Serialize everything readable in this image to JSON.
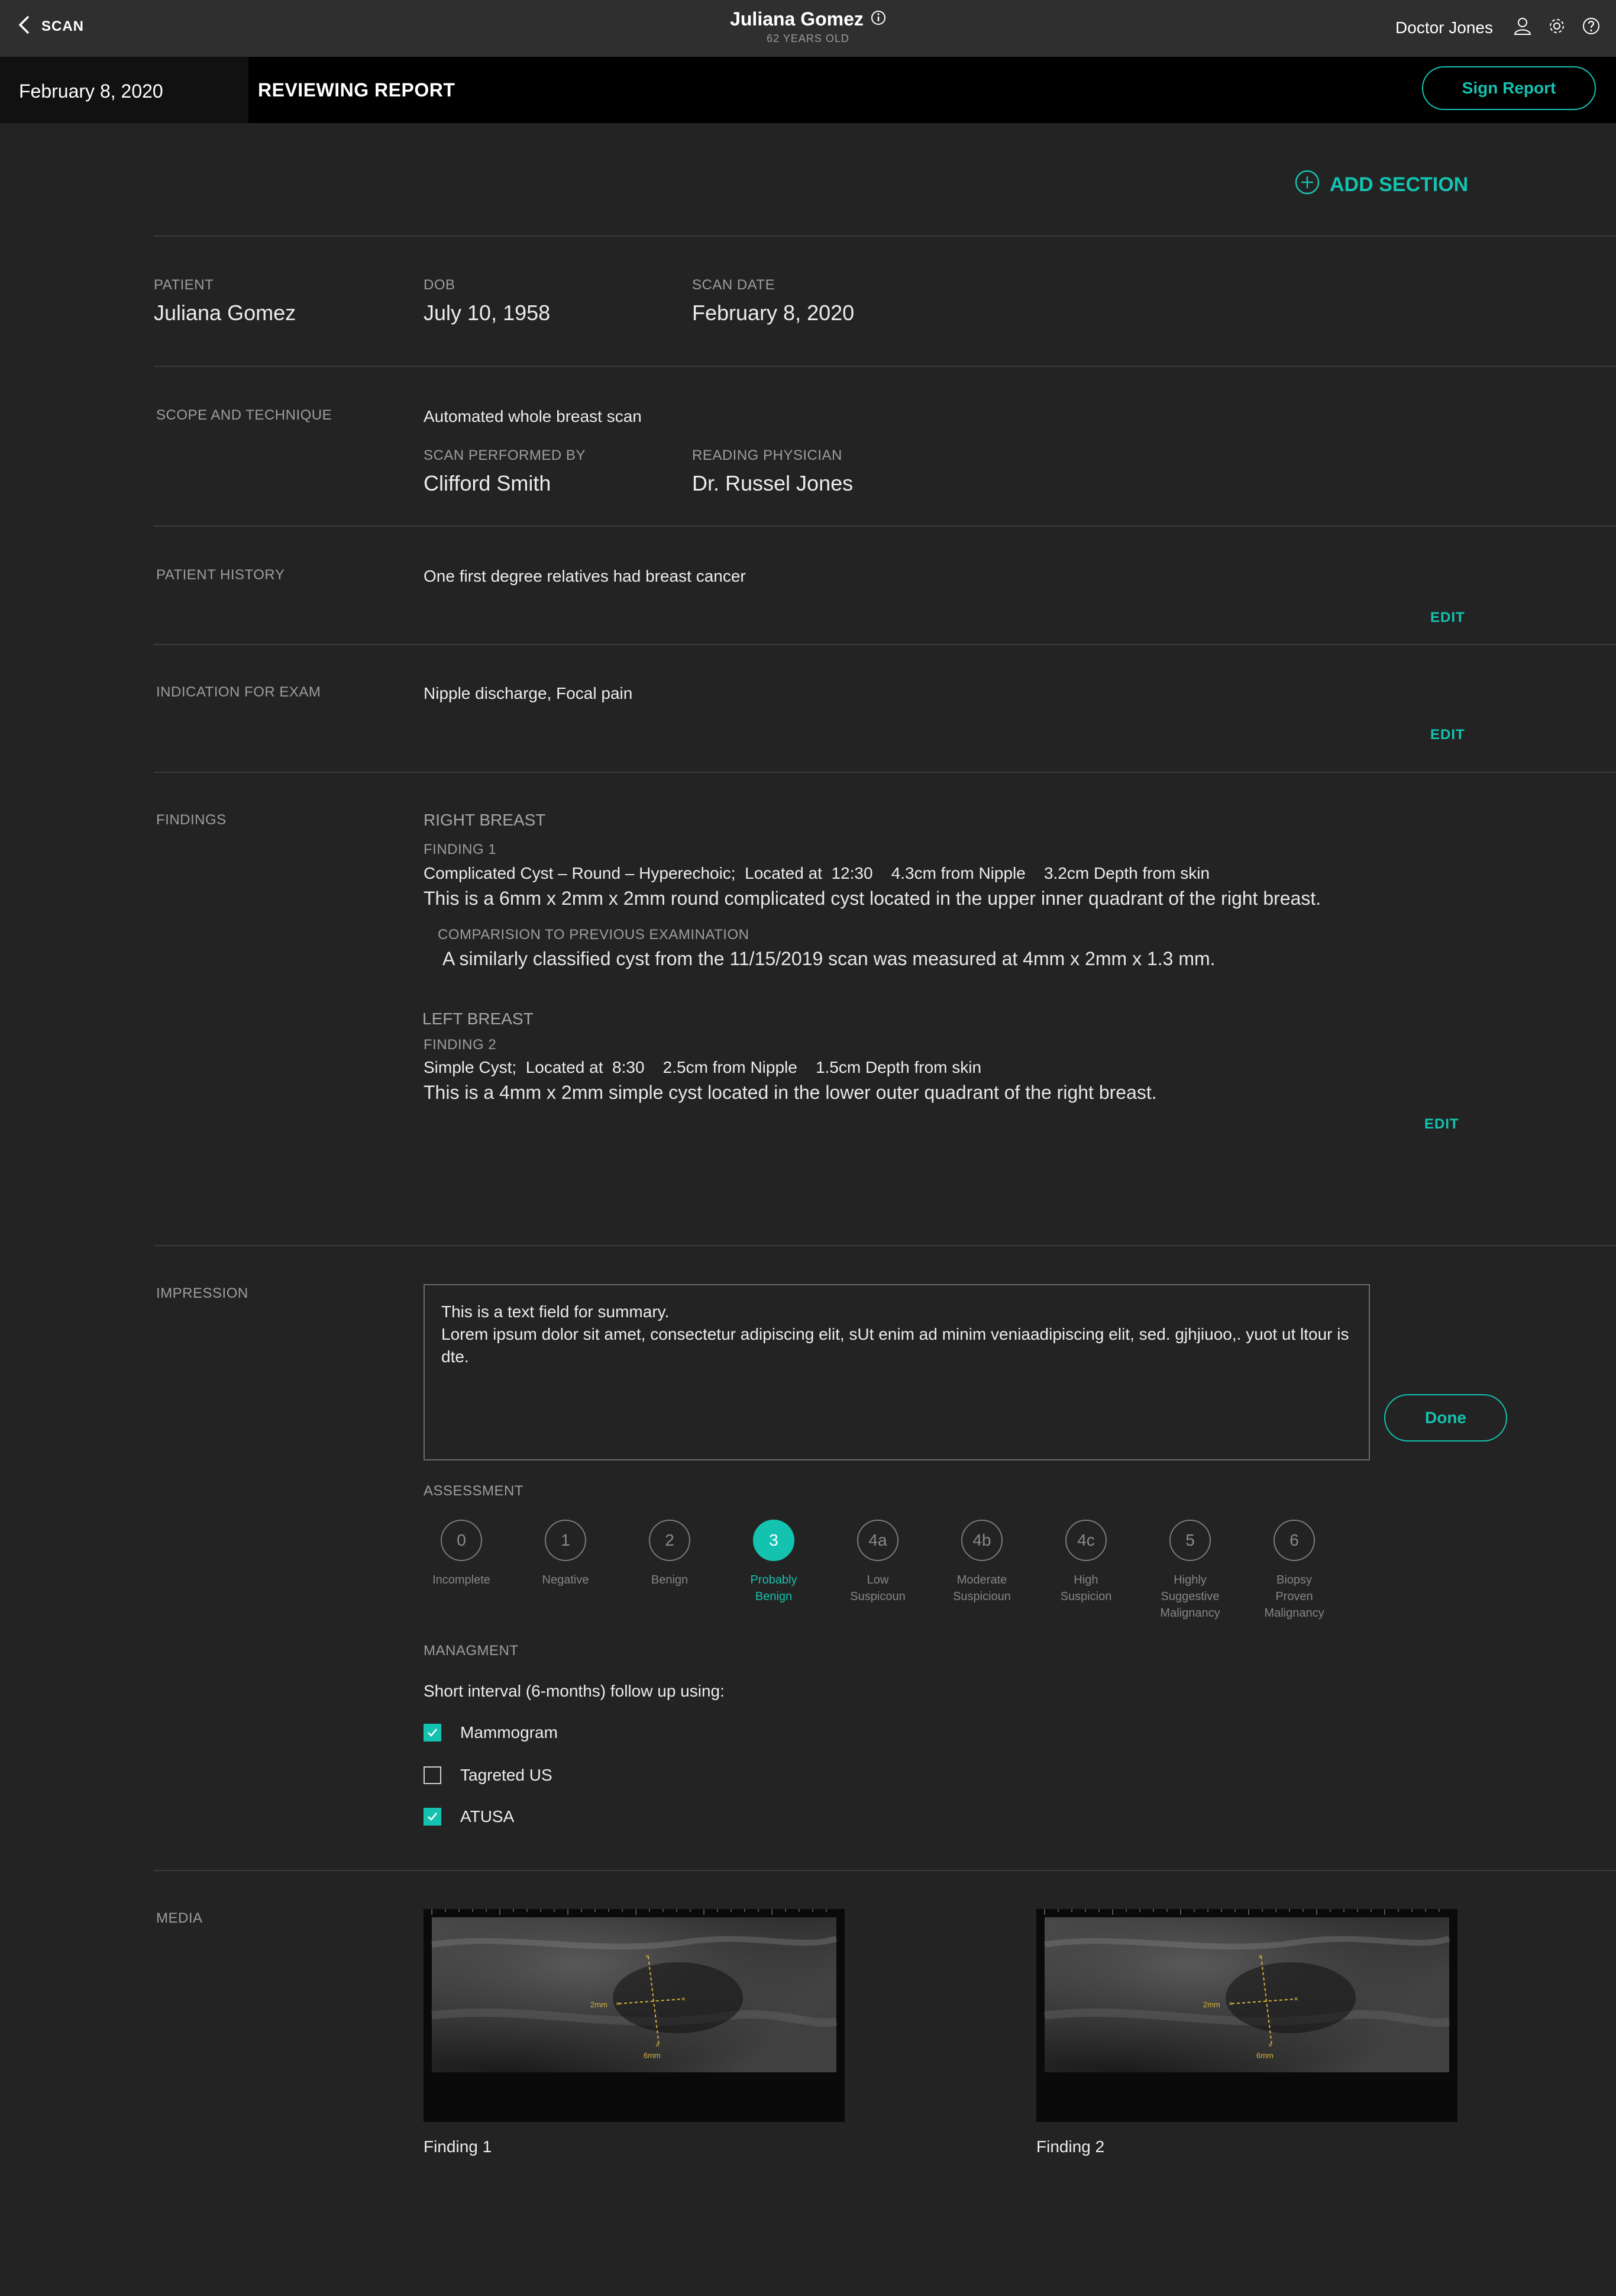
{
  "header": {
    "back_label": "SCAN",
    "patient_name": "Juliana Gomez",
    "patient_age": "62 YEARS OLD",
    "doctor_name": "Doctor Jones"
  },
  "subbar": {
    "date": "February 8, 2020",
    "title": "REVIEWING REPORT",
    "sign_label": "Sign Report"
  },
  "add_section_label": "ADD SECTION",
  "patient": {
    "patient_label": "PATIENT",
    "patient_value": "Juliana Gomez",
    "dob_label": "DOB",
    "dob_value": "July 10, 1958",
    "scan_date_label": "SCAN DATE",
    "scan_date_value": "February 8, 2020"
  },
  "scope": {
    "label": "SCOPE AND TECHNIQUE",
    "value": "Automated whole breast scan",
    "performed_label": "SCAN PERFORMED BY",
    "performed_value": "Clifford Smith",
    "physician_label": "READING PHYSICIAN",
    "physician_value": "Dr. Russel Jones"
  },
  "history": {
    "label": "PATIENT HISTORY",
    "value": "One first degree relatives had breast cancer",
    "edit_label": "EDIT"
  },
  "indication": {
    "label": "INDICATION FOR EXAM",
    "value": "Nipple discharge, Focal pain",
    "edit_label": "EDIT"
  },
  "findings": {
    "label": "FINDINGS",
    "right_title": "RIGHT BREAST",
    "f1_label": "FINDING 1",
    "f1_summary": "Complicated Cyst – Round – Hyperechoic;  Located at  12:30    4.3cm from Nipple    3.2cm Depth from skin",
    "f1_desc": "This is a 6mm x 2mm x 2mm round complicated cyst located in the upper inner quadrant of the right breast.",
    "comparison_label": "COMPARISION TO PREVIOUS EXAMINATION",
    "comparison_text": "A similarly classified cyst from the 11/15/2019 scan was measured at 4mm x 2mm x 1.3 mm.",
    "left_title": "LEFT BREAST",
    "f2_label": "FINDING 2",
    "f2_summary": "Simple Cyst;  Located at  8:30    2.5cm from Nipple    1.5cm Depth from skin",
    "f2_desc": "This is a 4mm x 2mm simple cyst located in the lower outer quadrant of the right breast.",
    "edit_label": "EDIT"
  },
  "impression": {
    "label": "IMPRESSION",
    "text_line1": "This is a text field for summary.",
    "text_line2": "Lorem ipsum dolor sit amet, consectetur adipiscing elit, sUt enim ad minim veniaadipiscing elit, sed. gjhjiuoo,. yuot ut ltour is dte.",
    "done_label": "Done"
  },
  "assessment": {
    "label": "ASSESSMENT",
    "selected": "3",
    "items": [
      {
        "value": "0",
        "cap1": "Incomplete",
        "cap2": "",
        "cap3": ""
      },
      {
        "value": "1",
        "cap1": "Negative",
        "cap2": "",
        "cap3": ""
      },
      {
        "value": "2",
        "cap1": "Benign",
        "cap2": "",
        "cap3": ""
      },
      {
        "value": "3",
        "cap1": "Probably",
        "cap2": "Benign",
        "cap3": ""
      },
      {
        "value": "4a",
        "cap1": "Low",
        "cap2": "Suspicoun",
        "cap3": ""
      },
      {
        "value": "4b",
        "cap1": "Moderate",
        "cap2": "Suspicioun",
        "cap3": ""
      },
      {
        "value": "4c",
        "cap1": "High",
        "cap2": "Suspicion",
        "cap3": ""
      },
      {
        "value": "5",
        "cap1": "Highly",
        "cap2": "Suggestive",
        "cap3": "Malignancy"
      },
      {
        "value": "6",
        "cap1": "Biopsy",
        "cap2": "Proven",
        "cap3": "Malignancy"
      }
    ]
  },
  "management": {
    "label": "MANAGMENT",
    "subtitle": "Short interval (6-months) follow up using:",
    "options": [
      {
        "label": "Mammogram",
        "checked": true
      },
      {
        "label": "Tagreted US",
        "checked": false
      },
      {
        "label": "ATUSA",
        "checked": true
      }
    ]
  },
  "media": {
    "label": "MEDIA",
    "items": [
      {
        "caption": "Finding 1",
        "meas_h": "2mm",
        "meas_v": "6mm"
      },
      {
        "caption": "Finding 2",
        "meas_h": "2mm",
        "meas_v": "6mm"
      }
    ]
  },
  "colors": {
    "accent": "#14c2b0",
    "background": "#232323",
    "topbar": "#2f2f2f",
    "subbar": "#000000"
  }
}
